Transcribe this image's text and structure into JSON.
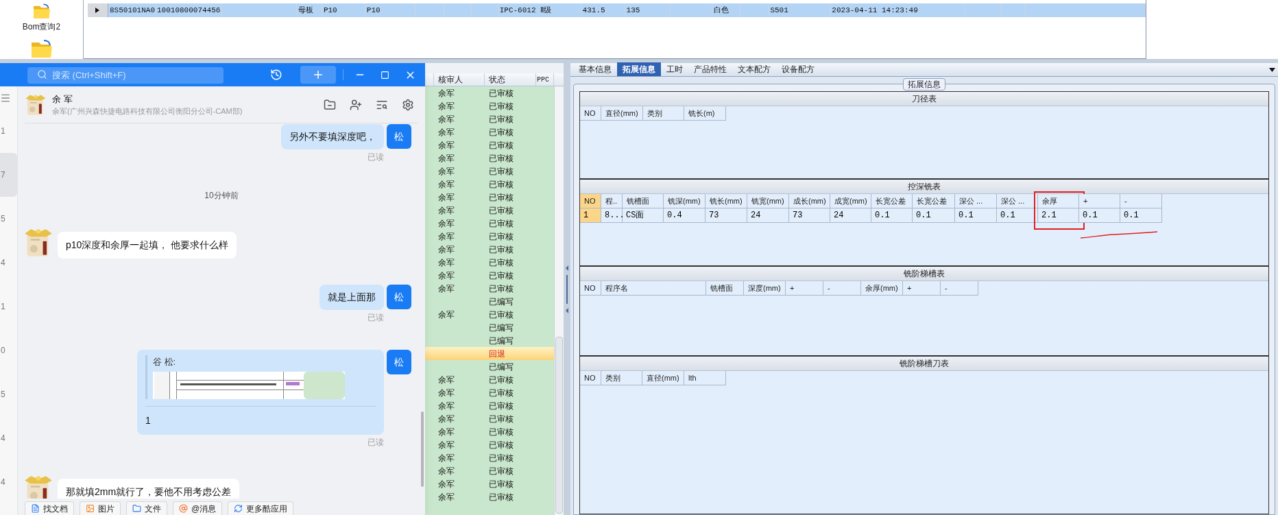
{
  "sidebar": {
    "items": [
      {
        "label": "Bom查询2"
      }
    ]
  },
  "top_table": {
    "rows": [
      {
        "selected": true,
        "cells": [
          "8S50101NA0",
          "10010800074456",
          null,
          "母板",
          "P10",
          "P10",
          null,
          null,
          null,
          "IPC-6012 Ⅱ级",
          "431.5",
          "135",
          null,
          "白色",
          null,
          "S501",
          "2023-04-11 14:23:49",
          null,
          null,
          null
        ]
      }
    ]
  },
  "chat": {
    "search": {
      "placeholder": "搜索 (Ctrl+Shift+F)"
    },
    "list_counts": [
      {
        "text": "1",
        "selected": false
      },
      {
        "text": "7",
        "selected": true
      },
      {
        "text": "5",
        "selected": false
      },
      {
        "text": "4",
        "selected": false
      },
      {
        "text": "1",
        "selected": false
      },
      {
        "text": "0",
        "selected": false
      },
      {
        "text": "5",
        "selected": false
      },
      {
        "text": "4",
        "selected": false
      },
      {
        "text": "4",
        "selected": false
      }
    ],
    "contact": {
      "name": "余 军",
      "subtitle": "余军(广州兴森快捷电路科技有限公司衡阳分公司-CAM部)"
    },
    "messages": [
      {
        "kind": "outgoing",
        "text": "另外不要填深度吧，",
        "avatar": "松",
        "status": "已读"
      },
      {
        "kind": "time",
        "text": "10分钟前"
      },
      {
        "kind": "incoming",
        "text": "p10深度和余厚一起填， 他要求什么样"
      },
      {
        "kind": "outgoing",
        "text": "就是上面那",
        "avatar": "松",
        "status": "已读"
      },
      {
        "kind": "quote",
        "quote_author": "谷 松:",
        "text": "1",
        "avatar": "松",
        "status": "已读"
      },
      {
        "kind": "incoming",
        "text": "那就填2mm就行了，要他不用考虑公差"
      }
    ],
    "toolbar": [
      "找文档",
      "图片",
      "文件",
      "@消息",
      "更多酷应用"
    ]
  },
  "review_grid": {
    "columns": [
      "核审人",
      "状态",
      "PPC"
    ],
    "rows": [
      {
        "reviewer": "余军",
        "status": "已审核",
        "selected": false
      },
      {
        "reviewer": "余军",
        "status": "已审核",
        "selected": false
      },
      {
        "reviewer": "余军",
        "status": "已审核",
        "selected": false
      },
      {
        "reviewer": "余军",
        "status": "已审核",
        "selected": false
      },
      {
        "reviewer": "余军",
        "status": "已审核",
        "selected": false
      },
      {
        "reviewer": "余军",
        "status": "已审核",
        "selected": false
      },
      {
        "reviewer": "余军",
        "status": "已审核",
        "selected": false
      },
      {
        "reviewer": "余军",
        "status": "已审核",
        "selected": false
      },
      {
        "reviewer": "余军",
        "status": "已审核",
        "selected": false
      },
      {
        "reviewer": "余军",
        "status": "已审核",
        "selected": false
      },
      {
        "reviewer": "余军",
        "status": "已审核",
        "selected": false
      },
      {
        "reviewer": "余军",
        "status": "已审核",
        "selected": false
      },
      {
        "reviewer": "余军",
        "status": "已审核",
        "selected": false
      },
      {
        "reviewer": "余军",
        "status": "已审核",
        "selected": false
      },
      {
        "reviewer": "余军",
        "status": "已审核",
        "selected": false
      },
      {
        "reviewer": "余军",
        "status": "已审核",
        "selected": false
      },
      {
        "status": "已编写",
        "selected": false
      },
      {
        "reviewer": "余军",
        "status": "已审核",
        "selected": false
      },
      {
        "status": "已编写",
        "selected": false
      },
      {
        "status": "已编写",
        "selected": false
      },
      {
        "status": "回退",
        "selected": true
      },
      {
        "status": "已编写",
        "selected": false
      },
      {
        "reviewer": "余军",
        "status": "已审核",
        "selected": false
      },
      {
        "reviewer": "余军",
        "status": "已审核",
        "selected": false
      },
      {
        "reviewer": "余军",
        "status": "已审核",
        "selected": false
      },
      {
        "reviewer": "余军",
        "status": "已审核",
        "selected": false
      },
      {
        "reviewer": "余军",
        "status": "已审核",
        "selected": false
      },
      {
        "reviewer": "余军",
        "status": "已审核",
        "selected": false
      },
      {
        "reviewer": "余军",
        "status": "已审核",
        "selected": false
      },
      {
        "reviewer": "余军",
        "status": "已审核",
        "selected": false
      },
      {
        "reviewer": "余军",
        "status": "已审核",
        "selected": false
      },
      {
        "reviewer": "余军",
        "status": "已审核",
        "selected": false
      }
    ]
  },
  "detail": {
    "tabs": [
      {
        "label": "基本信息",
        "selected": false
      },
      {
        "label": "拓展信息",
        "selected": true
      },
      {
        "label": "工时",
        "selected": false
      },
      {
        "label": "产品特性",
        "selected": false
      },
      {
        "label": "文本配方",
        "selected": false
      },
      {
        "label": "设备配方",
        "selected": false
      }
    ],
    "group_title": "拓展信息",
    "sections": [
      {
        "title": "刀径表",
        "columns": [
          "NO",
          "直径(mm)",
          "类别",
          "铣长(m)"
        ]
      },
      {
        "title": "控深铣表",
        "scribble": true,
        "columns": [
          {
            "label": "NO",
            "marked": false
          },
          {
            "label": "程..",
            "marked": false
          },
          {
            "label": "铣槽面",
            "marked": false
          },
          {
            "label": "铣深(mm)",
            "marked": false
          },
          {
            "label": "铣长(mm)",
            "marked": false
          },
          {
            "label": "铣宽(mm)",
            "marked": false
          },
          {
            "label": "成长(mm)",
            "marked": false
          },
          {
            "label": "成宽(mm)",
            "marked": false
          },
          {
            "label": "长宽公差",
            "marked": false
          },
          {
            "label": "长宽公差",
            "marked": false
          },
          {
            "label": "深公 ...",
            "marked": false
          },
          {
            "label": "深公 ...",
            "marked": false
          },
          {
            "label": "余厚",
            "marked": true
          },
          {
            "label": "+",
            "marked": false
          },
          {
            "label": "-",
            "marked": false
          }
        ],
        "rows": [
          {
            "selected": true,
            "cells": [
              "1",
              "8...",
              "CS面",
              "0.4",
              "73",
              "24",
              "73",
              "24",
              "0.1",
              "0.1",
              "0.1",
              "0.1",
              "2.1",
              "0.1",
              "0.1"
            ]
          }
        ]
      },
      {
        "title": "铣阶梯槽表",
        "columns": [
          "NO",
          "程序名",
          "铣槽面",
          "深度(mm)",
          "+",
          "-",
          "余厚(mm)",
          "+",
          "-"
        ]
      },
      {
        "title": "铣阶梯槽刀表",
        "columns": [
          "NO",
          "类别",
          "直径(mm)",
          "lth"
        ]
      }
    ]
  }
}
